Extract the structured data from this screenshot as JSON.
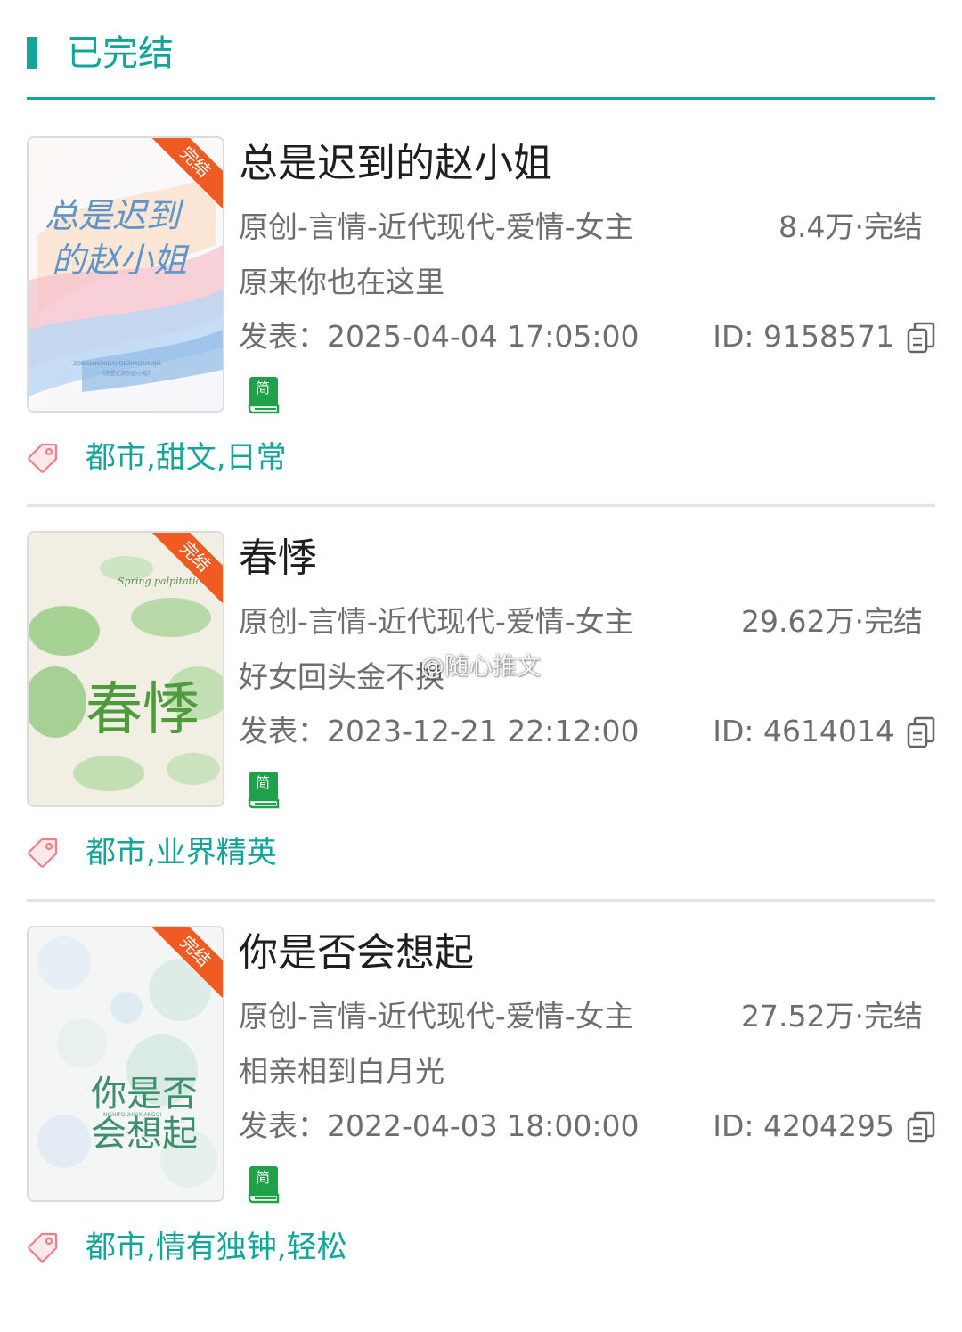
{
  "section": {
    "title": "已完结"
  },
  "books": [
    {
      "title": "总是迟到的赵小姐",
      "category": "原创-言情-近代现代-爱情-女主",
      "stats": "8.4万·完结",
      "intro": "原来你也在这里",
      "published": "发表：2025-04-04 17:05:00",
      "id": "ID: 9158571",
      "status_ribbon": "完结",
      "simplified_label": "简",
      "tags": "都市,甜文,日常",
      "cover": {
        "calligraphy_line1": "总是迟到",
        "calligraphy_line2": "的赵小姐",
        "pinyin": "ZONGSHICHIDAODEZHAOXIAOJIE",
        "caption": "《总是迟到的赵小姐》",
        "colors": [
          "#f9d3d8",
          "#fbe7cf",
          "#c9e2f6",
          "#87b6e3"
        ]
      }
    },
    {
      "title": "春悸",
      "category": "原创-言情-近代现代-爱情-女主",
      "stats": "29.62万·完结",
      "intro": "好女回头金不换",
      "published": "发表：2023-12-21 22:12:00",
      "id": "ID: 4614014",
      "status_ribbon": "完结",
      "simplified_label": "简",
      "tags": "都市,业界精英",
      "cover": {
        "english": "Spring palpitation",
        "calligraphy": "春悸",
        "colors": [
          "#f1efe3",
          "#7dc06a",
          "#9ed08f",
          "#4e9a3e"
        ]
      }
    },
    {
      "title": "你是否会想起",
      "category": "原创-言情-近代现代-爱情-女主",
      "stats": "27.52万·完结",
      "intro": "相亲相到白月光",
      "published": "发表：2022-04-03 18:00:00",
      "id": "ID: 4204295",
      "status_ribbon": "完结",
      "simplified_label": "简",
      "tags": "都市,情有独钟,轻松",
      "cover": {
        "calligraphy_line1": "你是否",
        "calligraphy_line2": "会想起",
        "pinyin": "NISHIFOUHUIXIANGQI",
        "colors": [
          "#f3f6f5",
          "#cfe8e2",
          "#d7e6f4",
          "#3d8f6e"
        ]
      }
    }
  ],
  "watermark": "@随心推文",
  "icons": {
    "copy": "copy-icon",
    "simplified": "book-simplified-icon",
    "tag": "tag-icon"
  },
  "theme": {
    "accent": "#14a59a",
    "ribbon": "#f05a23",
    "text_dark": "#1e1e1e",
    "text_muted": "#6e6e6e"
  }
}
